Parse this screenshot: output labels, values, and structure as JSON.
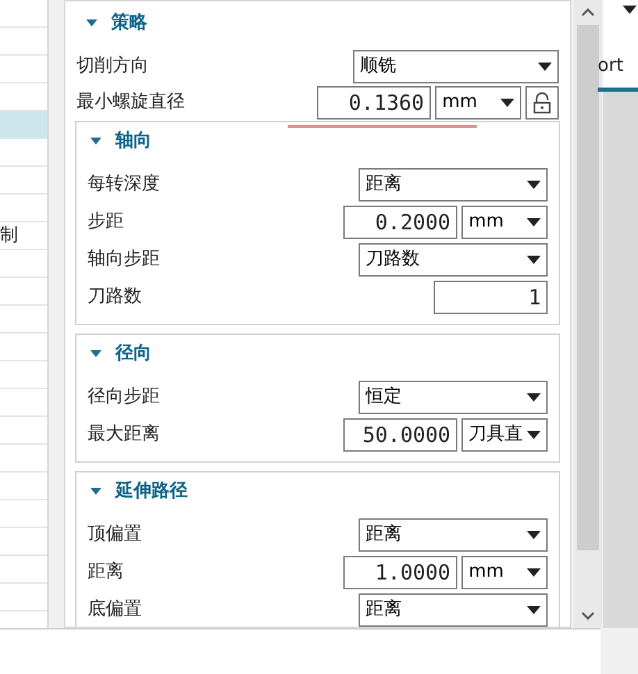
{
  "left_list": {
    "rows": [
      {
        "selected": false
      },
      {
        "selected": false
      },
      {
        "selected": false
      },
      {
        "selected": false
      },
      {
        "selected": true
      },
      {
        "selected": false
      },
      {
        "selected": false
      },
      {
        "selected": false
      },
      {
        "text": "制",
        "selected": false
      },
      {
        "selected": false
      },
      {
        "selected": false
      },
      {
        "selected": false
      },
      {
        "selected": false
      },
      {
        "selected": false
      },
      {
        "selected": false
      },
      {
        "selected": false
      },
      {
        "selected": false
      },
      {
        "selected": false
      },
      {
        "selected": false
      },
      {
        "selected": false
      },
      {
        "selected": false
      },
      {
        "selected": false
      }
    ]
  },
  "panel": {
    "title": "策略",
    "expanded": true,
    "rows": [
      {
        "label": "切削方向",
        "kind": "dropdown",
        "value": "顺铣"
      },
      {
        "label": "最小螺旋直径",
        "kind": "number_unit_lock",
        "value": "0.1360",
        "unit": "mm",
        "locked": false
      }
    ],
    "groups": [
      {
        "title": "轴向",
        "expanded": true,
        "rows": [
          {
            "label": "每转深度",
            "kind": "dropdown",
            "value": "距离"
          },
          {
            "label": "步距",
            "kind": "number_unit",
            "value": "0.2000",
            "unit": "mm"
          },
          {
            "label": "轴向步距",
            "kind": "dropdown",
            "value": "刀路数"
          },
          {
            "label": "刀路数",
            "kind": "number",
            "value": "1"
          }
        ]
      },
      {
        "title": "径向",
        "expanded": true,
        "rows": [
          {
            "label": "径向步距",
            "kind": "dropdown",
            "value": "恒定"
          },
          {
            "label": "最大距离",
            "kind": "number_unit",
            "value": "50.0000",
            "unit": "刀具直"
          }
        ]
      },
      {
        "title": "延伸路径",
        "expanded": true,
        "rows": [
          {
            "label": "顶偏置",
            "kind": "dropdown",
            "value": "距离"
          },
          {
            "label": "距离",
            "kind": "number_unit",
            "value": "1.0000",
            "unit": "mm"
          },
          {
            "label": "底偏置",
            "kind": "dropdown",
            "value": "距离"
          }
        ]
      }
    ]
  },
  "right_panel": {
    "tab": {
      "label": "ort",
      "selected": true
    }
  }
}
